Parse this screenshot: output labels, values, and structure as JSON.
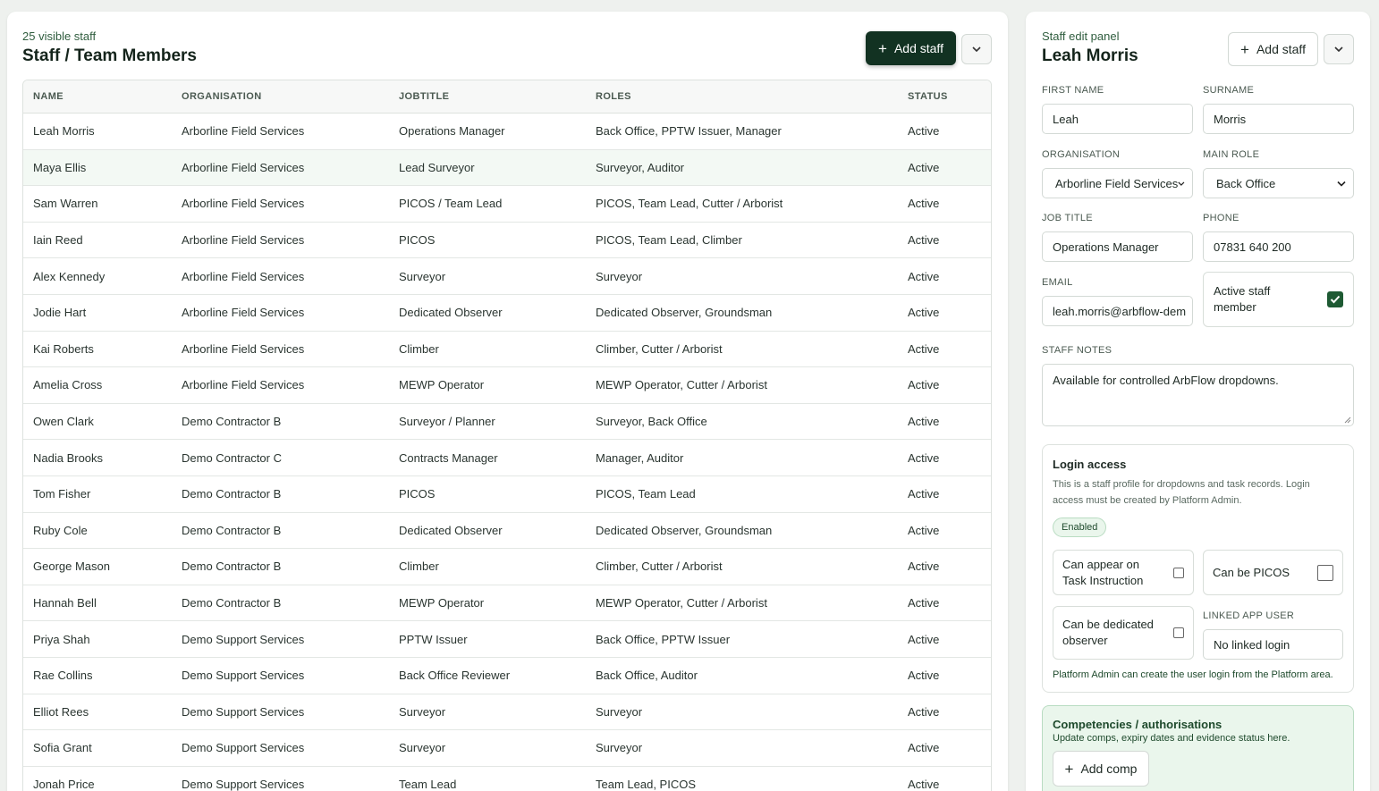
{
  "list": {
    "count_text": "25 visible staff",
    "title": "Staff / Team Members",
    "add_label": "Add staff",
    "columns": [
      "NAME",
      "ORGANISATION",
      "JOBTITLE",
      "ROLES",
      "STATUS"
    ],
    "rows": [
      [
        "Leah Morris",
        "Arborline Field Services",
        "Operations Manager",
        "Back Office, PPTW Issuer, Manager",
        "Active"
      ],
      [
        "Maya Ellis",
        "Arborline Field Services",
        "Lead Surveyor",
        "Surveyor, Auditor",
        "Active"
      ],
      [
        "Sam Warren",
        "Arborline Field Services",
        "PICOS / Team Lead",
        "PICOS, Team Lead, Cutter / Arborist",
        "Active"
      ],
      [
        "Iain Reed",
        "Arborline Field Services",
        "PICOS",
        "PICOS, Team Lead, Climber",
        "Active"
      ],
      [
        "Alex Kennedy",
        "Arborline Field Services",
        "Surveyor",
        "Surveyor",
        "Active"
      ],
      [
        "Jodie Hart",
        "Arborline Field Services",
        "Dedicated Observer",
        "Dedicated Observer, Groundsman",
        "Active"
      ],
      [
        "Kai Roberts",
        "Arborline Field Services",
        "Climber",
        "Climber, Cutter / Arborist",
        "Active"
      ],
      [
        "Amelia Cross",
        "Arborline Field Services",
        "MEWP Operator",
        "MEWP Operator, Cutter / Arborist",
        "Active"
      ],
      [
        "Owen Clark",
        "Demo Contractor B",
        "Surveyor / Planner",
        "Surveyor, Back Office",
        "Active"
      ],
      [
        "Nadia Brooks",
        "Demo Contractor C",
        "Contracts Manager",
        "Manager, Auditor",
        "Active"
      ],
      [
        "Tom Fisher",
        "Demo Contractor B",
        "PICOS",
        "PICOS, Team Lead",
        "Active"
      ],
      [
        "Ruby Cole",
        "Demo Contractor B",
        "Dedicated Observer",
        "Dedicated Observer, Groundsman",
        "Active"
      ],
      [
        "George Mason",
        "Demo Contractor B",
        "Climber",
        "Climber, Cutter / Arborist",
        "Active"
      ],
      [
        "Hannah Bell",
        "Demo Contractor B",
        "MEWP Operator",
        "MEWP Operator, Cutter / Arborist",
        "Active"
      ],
      [
        "Priya Shah",
        "Demo Support Services",
        "PPTW Issuer",
        "Back Office, PPTW Issuer",
        "Active"
      ],
      [
        "Rae Collins",
        "Demo Support Services",
        "Back Office Reviewer",
        "Back Office, Auditor",
        "Active"
      ],
      [
        "Elliot Rees",
        "Demo Support Services",
        "Surveyor",
        "Surveyor",
        "Active"
      ],
      [
        "Sofia Grant",
        "Demo Support Services",
        "Surveyor",
        "Surveyor",
        "Active"
      ],
      [
        "Jonah Price",
        "Demo Support Services",
        "Team Lead",
        "Team Lead, PICOS",
        "Active"
      ]
    ]
  },
  "panel": {
    "eyebrow": "Staff edit panel",
    "name": "Leah Morris",
    "add_label": "Add staff",
    "first_name_label": "FIRST NAME",
    "first_name": "Leah",
    "surname_label": "SURNAME",
    "surname": "Morris",
    "organisation_label": "ORGANISATION",
    "organisation": "Arborline Field Services",
    "main_role_label": "MAIN ROLE",
    "main_role": "Back Office",
    "job_title_label": "JOB TITLE",
    "job_title": "Operations Manager",
    "phone_label": "PHONE",
    "phone": "07831 640 200",
    "email_label": "EMAIL",
    "email": "leah.morris@arbflow-dem",
    "active_label": "Active staff member",
    "active_checked": true,
    "notes_label": "STAFF NOTES",
    "notes": "Available for controlled ArbFlow dropdowns.",
    "login": {
      "title": "Login access",
      "description": "This is a staff profile for dropdowns and task records. Login access must be created by Platform Admin.",
      "badge": "Enabled",
      "opt_task": "Can appear on Task Instruction",
      "opt_picos": "Can be PICOS",
      "opt_observer": "Can be dedicated observer",
      "linked_label": "LINKED APP USER",
      "linked_value": "No linked login",
      "note": "Platform Admin can create the user login from the Platform area."
    },
    "comps": {
      "title": "Competencies / authorisations",
      "subtitle": "Update comps, expiry dates and evidence status here.",
      "add_label": "Add comp"
    }
  },
  "colors": {
    "accent_dark": "#123222",
    "accent_green": "#1e5a33",
    "highlight_row": "#f3f9f4",
    "comps_bg": "#eaf6ec"
  }
}
